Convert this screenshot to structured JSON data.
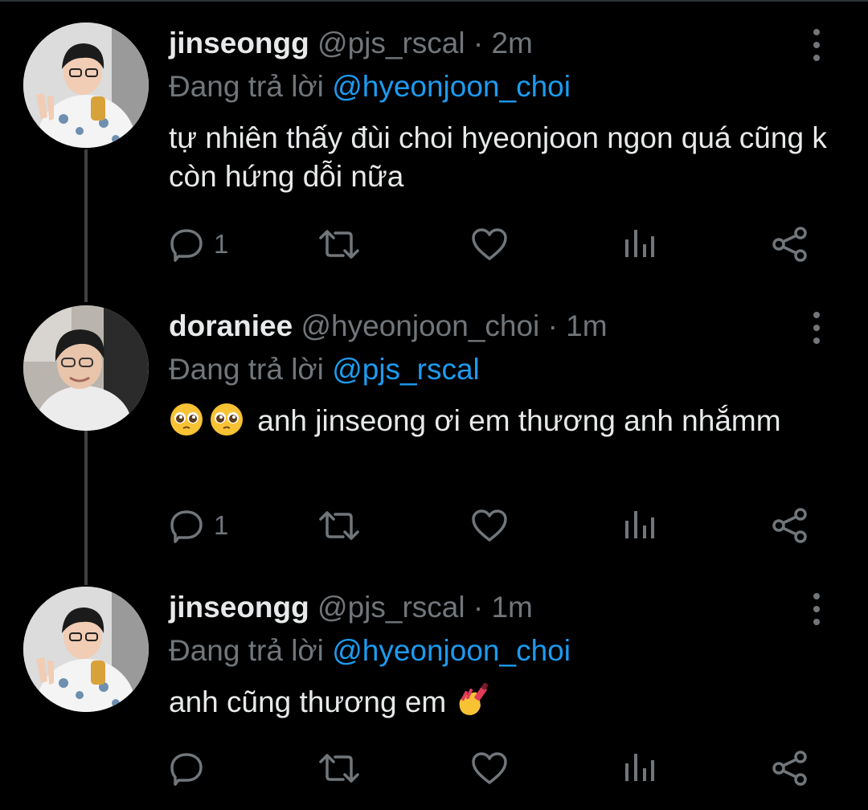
{
  "reply_prefix": "Đang trả lời",
  "tweets": [
    {
      "name": "jinseongg",
      "handle": "@pjs_rscal",
      "sep": "·",
      "time": "2m",
      "reply_to": "@hyeonjoon_choi",
      "text": "tự nhiên thấy đùi choi hyeonjoon ngon quá cũng k còn hứng dỗi nữa",
      "reply_count": "1",
      "avatar_icon": "profile-photo-jinseongg"
    },
    {
      "name": "doraniee",
      "handle": "@hyeonjoon_choi",
      "sep": "·",
      "time": "1m",
      "reply_to": "@pjs_rscal",
      "text_emoji": [
        "🥺",
        "🥺"
      ],
      "text": "anh jinseong ơi em thương anh nhắmm",
      "reply_count": "1",
      "avatar_icon": "profile-photo-doraniee"
    },
    {
      "name": "jinseongg",
      "handle": "@pjs_rscal",
      "sep": "·",
      "time": "1m",
      "reply_to": "@hyeonjoon_choi",
      "text": "anh cũng thương em",
      "text_emoji_after": "💅",
      "reply_count": "",
      "avatar_icon": "profile-photo-jinseongg"
    }
  ],
  "colors": {
    "background": "#000000",
    "text": "#e7e9ea",
    "secondary": "#71767b",
    "mention": "#1d9bf0",
    "thread_line": "#3e4144"
  }
}
